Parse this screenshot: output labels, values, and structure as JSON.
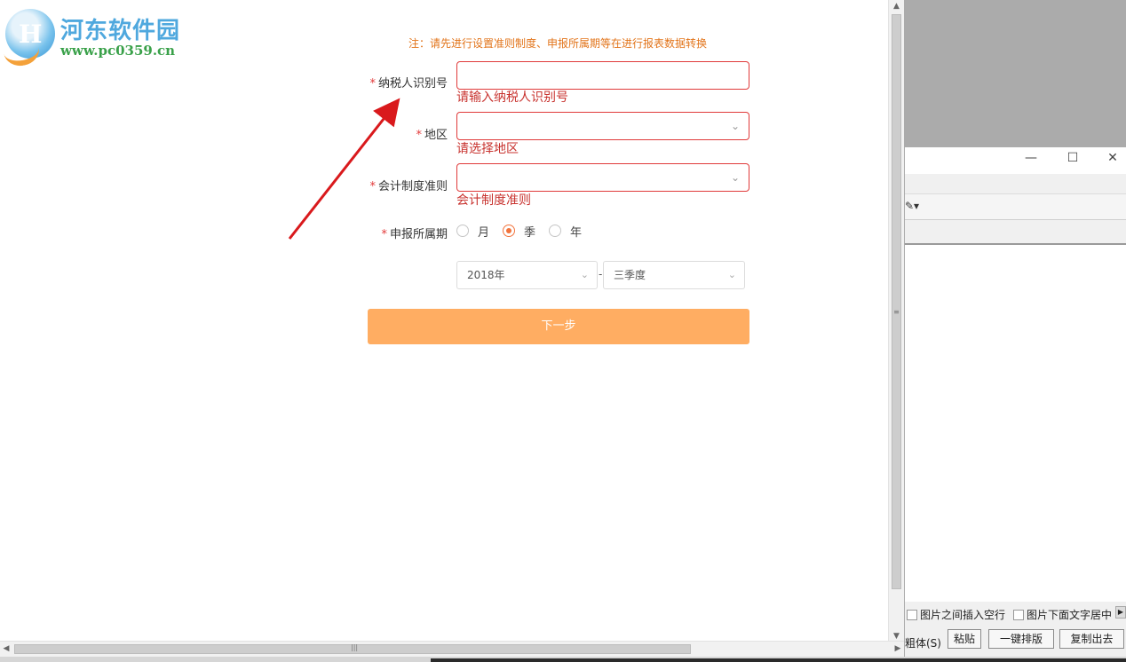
{
  "logo": {
    "title": "河东软件园",
    "url": "www.pc0359.cn"
  },
  "form": {
    "note": "注：请先进行设置准则制度、申报所属期等在进行报表数据转换",
    "required_mark": "*",
    "taxpayer_id": {
      "label": "纳税人识别号",
      "value": "",
      "error": "请输入纳税人识别号"
    },
    "region": {
      "label": "地区",
      "value": "",
      "error": "请选择地区"
    },
    "accounting": {
      "label": "会计制度准则",
      "value": "",
      "error": "会计制度准则"
    },
    "period": {
      "label": "申报所属期",
      "options": [
        "月",
        "季",
        "年"
      ],
      "selected": "季",
      "year": "2018年",
      "separator": "-",
      "quarter": "三季度"
    },
    "next_button": "下一步"
  },
  "colors": {
    "accent": "#ffad62",
    "error": "#e03a3a",
    "note": "#e2741a",
    "radio_selected": "#f2733c",
    "arrow": "#d9191c"
  },
  "side_window": {
    "controls": {
      "minimize": "—",
      "maximize": "☐",
      "close": "✕"
    },
    "option1": "图片之间插入空行",
    "option2": "图片下面文字居中",
    "bold_label": "粗体(S)",
    "paste_button": "粘贴",
    "layout_button": "一键排版",
    "copy_button": "复制出去"
  },
  "scrollbar_glyphs": {
    "up": "▲",
    "down": "▼",
    "left": "◀",
    "right": "▶",
    "grip": "≡",
    "hgrip": "|||"
  }
}
